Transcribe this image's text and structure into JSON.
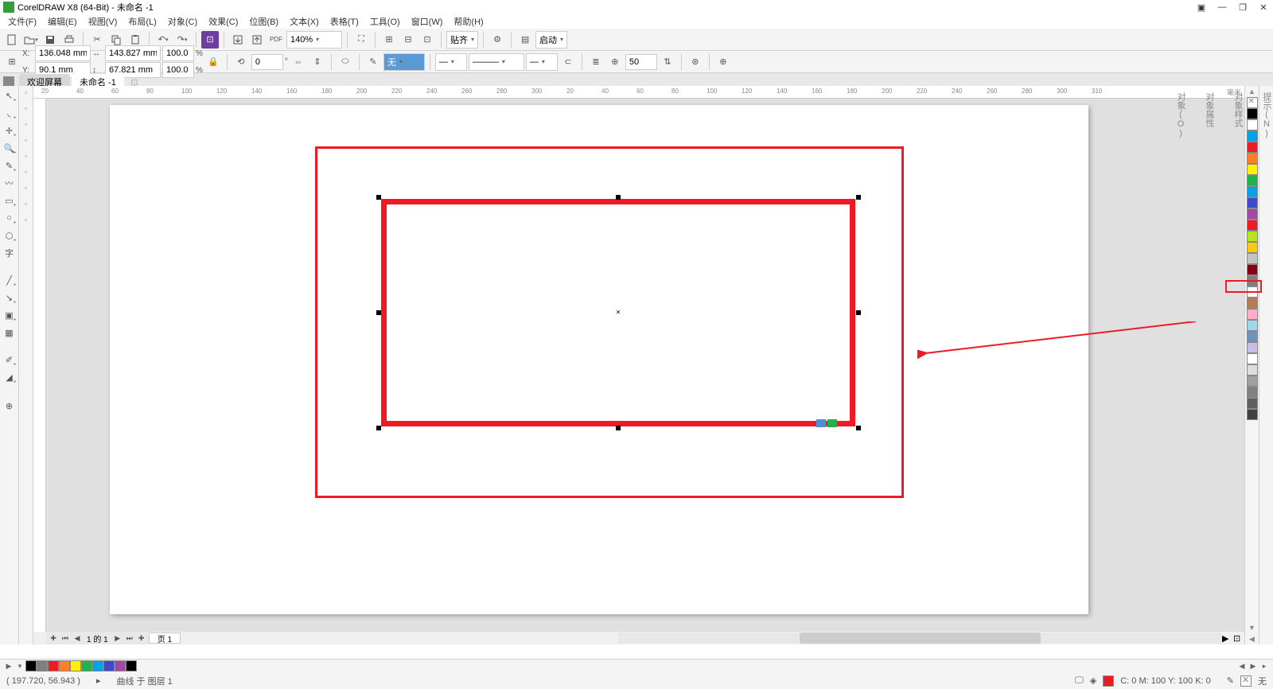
{
  "app": {
    "title": "CorelDRAW X8 (64-Bit) - 未命名 -1"
  },
  "menu": {
    "items": [
      "文件(F)",
      "编辑(E)",
      "视图(V)",
      "布局(L)",
      "对象(C)",
      "效果(C)",
      "位图(B)",
      "文本(X)",
      "表格(T)",
      "工具(O)",
      "窗口(W)",
      "帮助(H)"
    ]
  },
  "toolbar1": {
    "zoom": "140%",
    "snap": "贴齐",
    "launch": "启动"
  },
  "props": {
    "x": "136.048 mm",
    "y": "90.1 mm",
    "w": "143.827 mm",
    "h": "67.821 mm",
    "sx": "100.0",
    "sy": "100.0",
    "pct": "%",
    "angle": "0",
    "outline": "无",
    "wrap": "50"
  },
  "doctabs": {
    "welcome": "欢迎屏幕",
    "doc1": "未命名 -1"
  },
  "pagenav": {
    "label": "1 的 1",
    "page1": "页 1"
  },
  "status": {
    "coords": "( 197.720, 56.943 )",
    "cursor": "▸",
    "object": "曲线 于 图层 1",
    "fill_none": "无",
    "color_info": "C: 0 M: 100 Y: 100 K: 0"
  },
  "ruler_unit": "毫米",
  "ruler_ticks": [
    "20",
    "40",
    "60",
    "80",
    "100",
    "120",
    "140",
    "160",
    "180",
    "200",
    "220",
    "240",
    "260",
    "280",
    "300",
    "20",
    "40",
    "60",
    "80",
    "100",
    "120",
    "140",
    "160",
    "180",
    "200",
    "220",
    "240",
    "260",
    "280",
    "300",
    "310"
  ],
  "palette": {
    "colors": [
      "#000000",
      "#ffffff",
      "#00a2e8",
      "#ed1c24",
      "#ff7f27",
      "#fff200",
      "#22b14c",
      "#00a2e8",
      "#3f48cc",
      "#a349a4",
      "#ed1c24",
      "#b5e61d",
      "#ffc90e",
      "#c3c3c3",
      "#880015",
      "#7f7f7f",
      "#ffffff",
      "#b97a57",
      "#ffaec9",
      "#99d9ea",
      "#7092be",
      "#c8bfe7",
      "#ffffff",
      "#dcdcdc",
      "#a0a0a0",
      "#808080",
      "#606060",
      "#404040"
    ]
  },
  "status_palette": [
    "#000000",
    "#7f7f7f",
    "#ed1c24",
    "#ff7f27",
    "#fff200",
    "#22b14c",
    "#00a2e8",
    "#3f48cc",
    "#a349a4",
    "#000000"
  ],
  "dockers": [
    "提示(N)",
    "对象样式",
    "对象属性",
    "对象(O)"
  ]
}
